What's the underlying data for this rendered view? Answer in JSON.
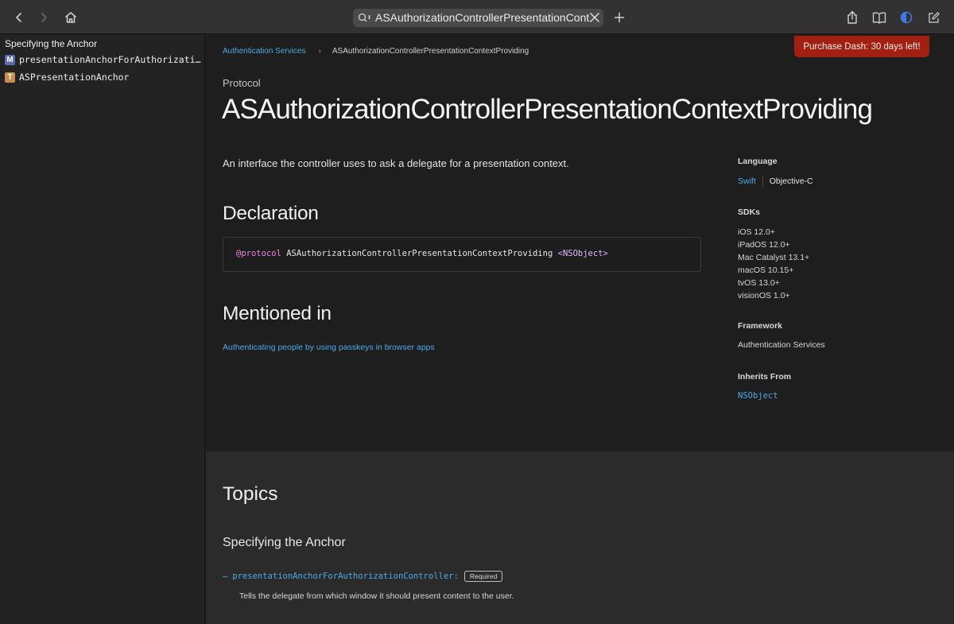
{
  "toolbar": {
    "search_text": "ASAuthorizationControllerPresentationContextPro"
  },
  "sidebar": {
    "heading": "Specifying the Anchor",
    "items": [
      {
        "badge": "M",
        "badge_color": "#5a6bb0",
        "label": "presentationAnchorForAuthorizationController:"
      },
      {
        "badge": "T",
        "badge_color": "#c98d52",
        "label": "ASPresentationAnchor"
      }
    ]
  },
  "breadcrumb": {
    "root": "Authentication Services",
    "separator": "›",
    "current": "ASAuthorizationControllerPresentationContextProviding"
  },
  "purchase_banner": "Purchase Dash: 30 days left!",
  "page": {
    "eyebrow": "Protocol",
    "title": "ASAuthorizationControllerPresentationContextProviding",
    "abstract": "An interface the controller uses to ask a delegate for a presentation context."
  },
  "declaration": {
    "heading": "Declaration",
    "keyword": "@protocol",
    "name": "ASAuthorizationControllerPresentationContextProviding",
    "open": "<",
    "conforms": "NSObject",
    "close": ">"
  },
  "mentioned": {
    "heading": "Mentioned in",
    "link": "Authenticating people by using passkeys in browser apps"
  },
  "aside": {
    "language_label": "Language",
    "language_swift": "Swift",
    "language_objc": "Objective-C",
    "sdks_label": "SDKs",
    "sdks": [
      "iOS 12.0+",
      "iPadOS 12.0+",
      "Mac Catalyst 13.1+",
      "macOS 10.15+",
      "tvOS 13.0+",
      "visionOS 1.0+"
    ],
    "framework_label": "Framework",
    "framework": "Authentication Services",
    "inherits_label": "Inherits From",
    "inherits": "NSObject"
  },
  "topics": {
    "heading": "Topics",
    "section": "Specifying the Anchor",
    "item_dash": "–",
    "item_name": "presentationAnchorForAuthorizationController:",
    "item_badge": "Required",
    "item_desc": "Tells the delegate from which window it should present content to the user."
  },
  "colors": {
    "link": "#4ea9e8",
    "banner": "#a12012"
  }
}
